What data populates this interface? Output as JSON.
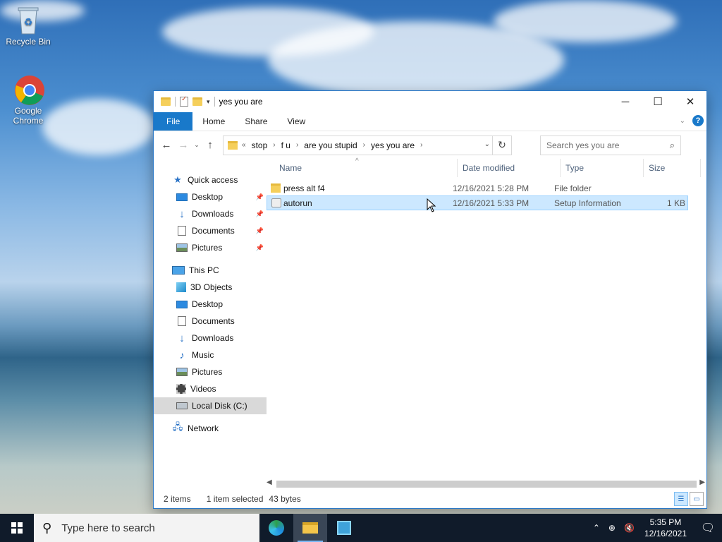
{
  "desktop": {
    "icons": [
      {
        "label": "Recycle Bin",
        "icon": "recycle-bin-icon"
      },
      {
        "label": "Google Chrome",
        "icon": "chrome-icon"
      }
    ]
  },
  "window": {
    "title": "yes you are",
    "controls": {
      "minimize": "─",
      "maximize": "☐",
      "close": "✕"
    },
    "ribbon": {
      "tabs": [
        "File",
        "Home",
        "Share",
        "View"
      ],
      "help": "?",
      "chevron": "⌄"
    },
    "nav": {
      "back": "←",
      "forward": "→",
      "recent": "⌄",
      "up": "↑",
      "breadcrumb": [
        "stop",
        "f u",
        "are you stupid",
        "yes you are"
      ],
      "overflow": "«",
      "refresh": "↻",
      "search_placeholder": "Search yes you are"
    },
    "navpane": {
      "quick_access": {
        "label": "Quick access",
        "items": [
          "Desktop",
          "Downloads",
          "Documents",
          "Pictures"
        ]
      },
      "this_pc": {
        "label": "This PC",
        "items": [
          "3D Objects",
          "Desktop",
          "Documents",
          "Downloads",
          "Music",
          "Pictures",
          "Videos",
          "Local Disk (C:)"
        ]
      },
      "network": {
        "label": "Network"
      }
    },
    "columns": {
      "name": "Name",
      "date": "Date modified",
      "type": "Type",
      "size": "Size"
    },
    "files": [
      {
        "name": "press alt f4",
        "date": "12/16/2021 5:28 PM",
        "type": "File folder",
        "size": "",
        "selected": false
      },
      {
        "name": "autorun",
        "date": "12/16/2021 5:33 PM",
        "type": "Setup Information",
        "size": "1 KB",
        "selected": true
      }
    ],
    "status": {
      "items": "2 items",
      "selected": "1 item selected",
      "bytes": "43 bytes"
    }
  },
  "taskbar": {
    "search_placeholder": "Type here to search",
    "time": "5:35 PM",
    "date": "12/16/2021"
  }
}
